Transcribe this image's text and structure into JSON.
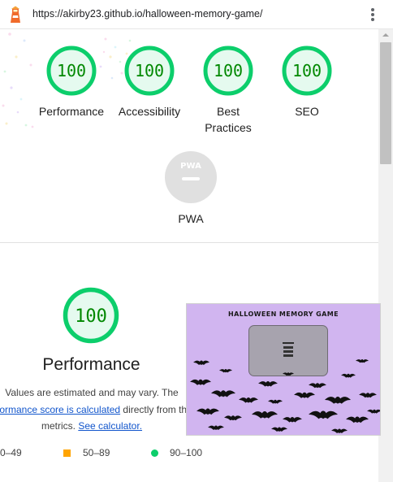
{
  "browser": {
    "url": "https://akirby23.github.io/halloween-memory-game/",
    "logo_icon": "lighthouse-icon",
    "menu_icon": "kebab-menu-icon"
  },
  "colors": {
    "pass_green": "#0cce6b",
    "pass_text": "#008800",
    "pass_fill": "#e5faef",
    "average_orange": "#ffa400",
    "fail_red": "#ff4e42",
    "link_blue": "#1155cc",
    "pwa_gray": "#e0e0e0",
    "screenshot_bg": "#d1b5f0"
  },
  "gauges": [
    {
      "label": "Performance",
      "score": "100"
    },
    {
      "label": "Accessibility",
      "score": "100"
    },
    {
      "label": "Best",
      "label2": "Practices",
      "score": "100"
    },
    {
      "label": "SEO",
      "score": "100"
    }
  ],
  "pwa": {
    "badge_text": "PWA",
    "label": "PWA",
    "icon": "pwa-badge-icon"
  },
  "performance": {
    "score": "100",
    "title": "Performance",
    "line1": "Values are estimated and may vary. The",
    "link1": "rformance score is calculated",
    "line2_rest": " directly from the",
    "line3_pre": "metrics. ",
    "link2": "See calculator."
  },
  "screenshot": {
    "title": "HALLOWEEN MEMORY GAME"
  },
  "legend": {
    "fail": "0–49",
    "average": "50–89",
    "pass": "90–100"
  }
}
